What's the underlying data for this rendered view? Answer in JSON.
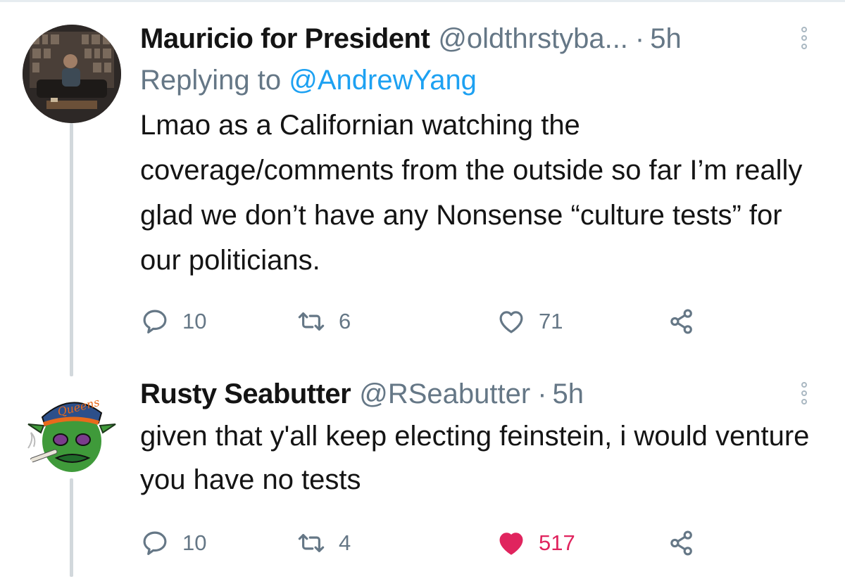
{
  "tweets": [
    {
      "name": "Mauricio for President",
      "handle": "@oldthrstyba...",
      "dot": "·",
      "time": "5h",
      "replying_prefix": "Replying to",
      "replying_to": "@AndrewYang",
      "text": "Lmao as a Californian watching the coverage/comments from the outside so far I’m really glad we don’t have any Nonsense “culture tests” for our politicians.",
      "replies": "10",
      "retweets": "6",
      "likes": "71",
      "liked": false
    },
    {
      "name": "Rusty Seabutter",
      "handle": "@RSeabutter",
      "dot": "·",
      "time": "5h",
      "text": "given that y'all keep electing feinstein, i would venture you have no tests",
      "replies": "10",
      "retweets": "4",
      "likes": "517",
      "liked": true
    }
  ],
  "colors": {
    "name": "#141414",
    "muted": "#657786",
    "link": "#1da1f2",
    "like_active": "#e0245e",
    "thread_line": "#d2d8dc"
  },
  "icons": [
    "reply-icon",
    "retweet-icon",
    "like-icon",
    "share-icon",
    "more-options-icon"
  ]
}
